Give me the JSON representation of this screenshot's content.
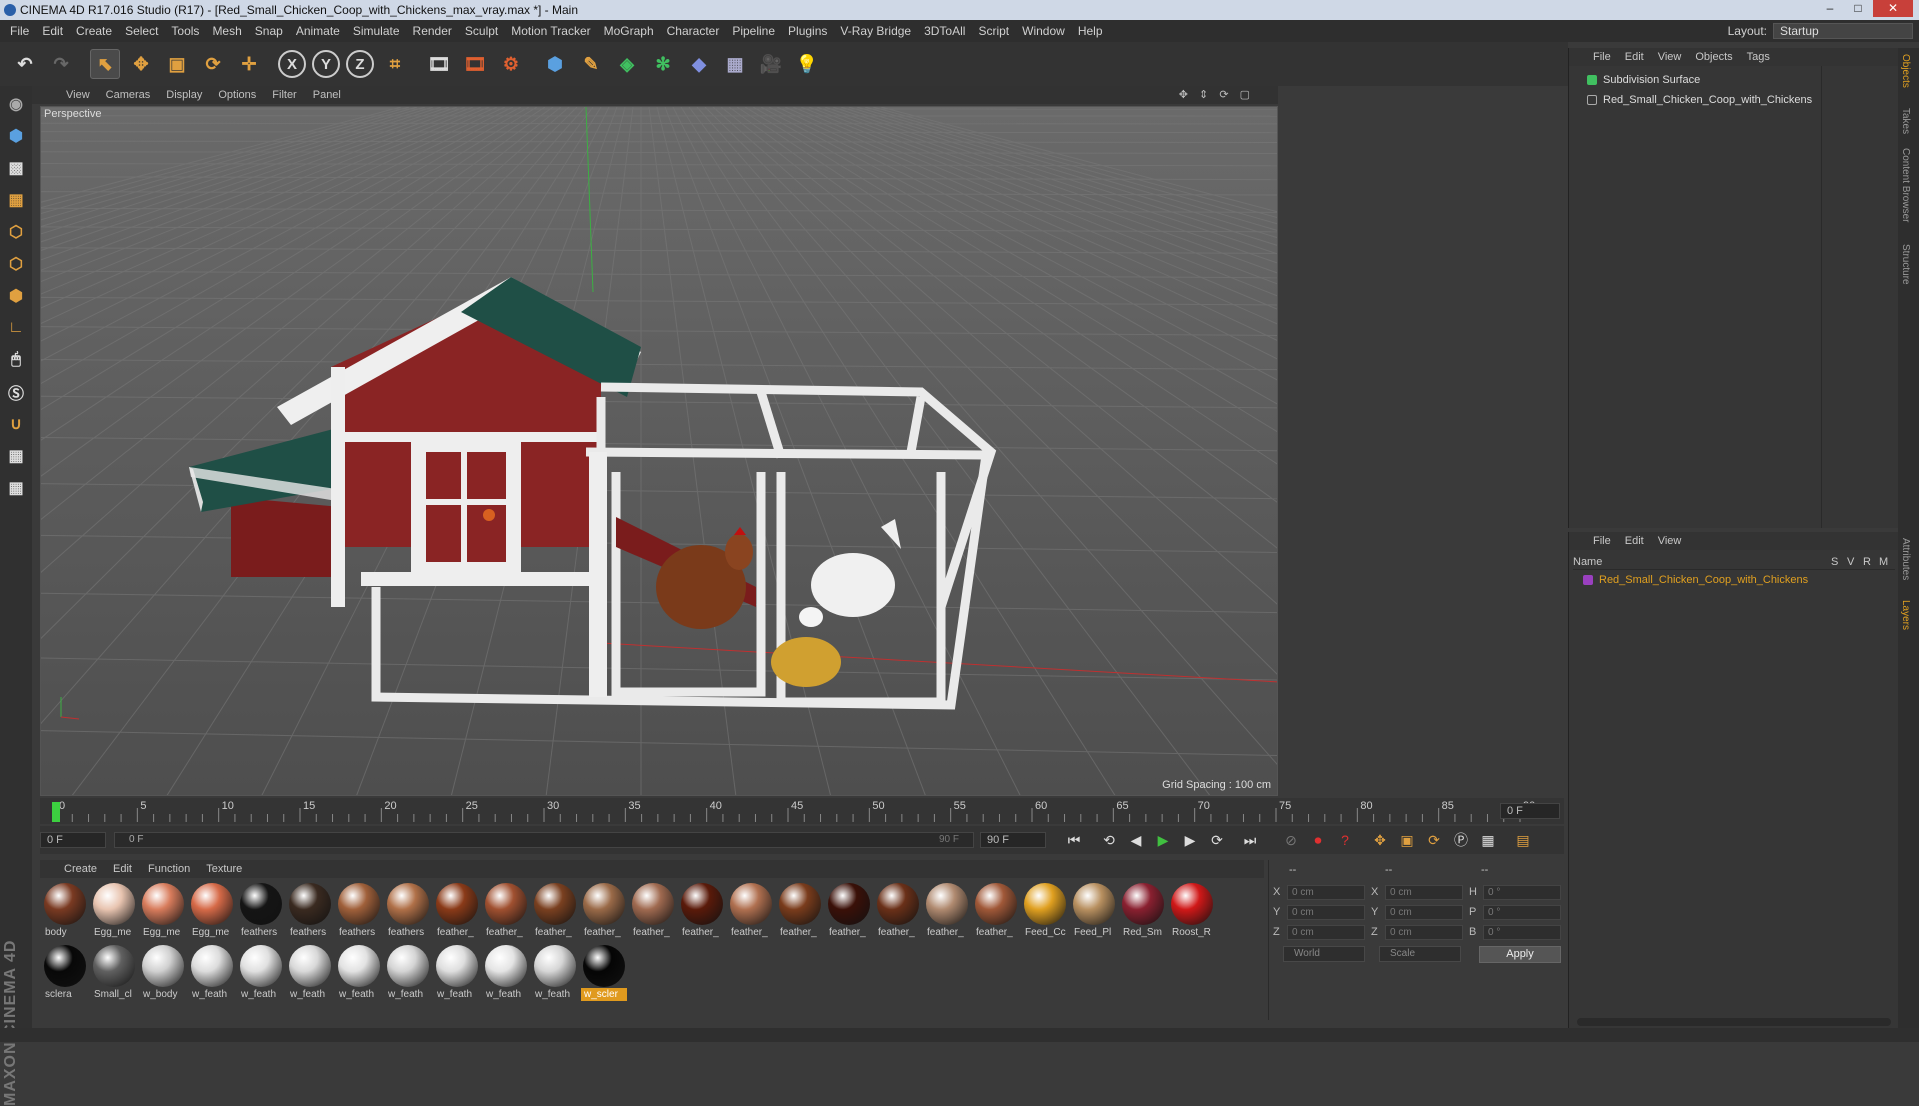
{
  "window": {
    "title": "CINEMA 4D R17.016 Studio (R17) - [Red_Small_Chicken_Coop_with_Chickens_max_vray.max *] - Main"
  },
  "menubar": {
    "items": [
      "File",
      "Edit",
      "Create",
      "Select",
      "Tools",
      "Mesh",
      "Snap",
      "Animate",
      "Simulate",
      "Render",
      "Sculpt",
      "Motion Tracker",
      "MoGraph",
      "Character",
      "Pipeline",
      "Plugins",
      "V-Ray Bridge",
      "3DToAll",
      "Script",
      "Window",
      "Help"
    ],
    "layout_label": "Layout:",
    "layout_value": "Startup"
  },
  "viewport": {
    "menu": [
      "View",
      "Cameras",
      "Display",
      "Options",
      "Filter",
      "Panel"
    ],
    "label": "Perspective",
    "grid_spacing": "Grid Spacing : 100 cm"
  },
  "timeline": {
    "ticks": [
      "0",
      "5",
      "10",
      "15",
      "20",
      "25",
      "30",
      "35",
      "40",
      "45",
      "50",
      "55",
      "60",
      "65",
      "70",
      "75",
      "80",
      "85",
      "90"
    ],
    "end_field": "0 F"
  },
  "playbar": {
    "current": "0 F",
    "range_start": "0 F",
    "range_end": "90 F",
    "end": "90 F"
  },
  "material_menu": [
    "Create",
    "Edit",
    "Function",
    "Texture"
  ],
  "materials": [
    {
      "name": "body",
      "color": "#7a3a22"
    },
    {
      "name": "Egg_me",
      "color": "#e8c4b0"
    },
    {
      "name": "Egg_me",
      "color": "#d87c5c"
    },
    {
      "name": "Egg_me",
      "color": "#d66a48"
    },
    {
      "name": "feathers",
      "color": "#151515"
    },
    {
      "name": "feathers",
      "color": "#3a2a20"
    },
    {
      "name": "feathers",
      "color": "#a0603a"
    },
    {
      "name": "feathers",
      "color": "#b07048"
    },
    {
      "name": "feather_",
      "color": "#8a3a18"
    },
    {
      "name": "feather_",
      "color": "#a05030"
    },
    {
      "name": "feather_",
      "color": "#7a4020"
    },
    {
      "name": "feather_",
      "color": "#9a6a48"
    },
    {
      "name": "feather_",
      "color": "#a06a50"
    },
    {
      "name": "feather_",
      "color": "#5a1a0a"
    },
    {
      "name": "feather_",
      "color": "#b07050"
    },
    {
      "name": "feather_",
      "color": "#7a3c1c"
    },
    {
      "name": "feather_",
      "color": "#3a1008"
    },
    {
      "name": "feather_",
      "color": "#6a3018"
    },
    {
      "name": "feather_",
      "color": "#b08a70"
    },
    {
      "name": "feather_",
      "color": "#a05838"
    },
    {
      "name": "Feed_Cc",
      "color": "#e0a020"
    },
    {
      "name": "Feed_Pl",
      "color": "#b89060"
    },
    {
      "name": "Red_Sm",
      "color": "#8a2030"
    },
    {
      "name": "Roost_R",
      "color": "#d01818"
    },
    {
      "name": "sclera",
      "color": "#080808"
    },
    {
      "name": "Small_cl",
      "color": "#606060"
    },
    {
      "name": "w_body",
      "color": "#d0d0d0"
    },
    {
      "name": "w_feath",
      "color": "#dcdcdc"
    },
    {
      "name": "w_feath",
      "color": "#e0e0e0"
    },
    {
      "name": "w_feath",
      "color": "#d8d8d8"
    },
    {
      "name": "w_feath",
      "color": "#e2e2e2"
    },
    {
      "name": "w_feath",
      "color": "#d4d4d4"
    },
    {
      "name": "w_feath",
      "color": "#dedede"
    },
    {
      "name": "w_feath",
      "color": "#e4e4e4"
    },
    {
      "name": "w_feath",
      "color": "#d6d6d6"
    },
    {
      "name": "w_scler",
      "color": "#050505"
    }
  ],
  "attributes": {
    "header": [
      "--",
      "--",
      "--"
    ],
    "rows": [
      [
        "X",
        "0 cm",
        "X",
        "0 cm",
        "H",
        "0 °"
      ],
      [
        "Y",
        "0 cm",
        "Y",
        "0 cm",
        "P",
        "0 °"
      ],
      [
        "Z",
        "0 cm",
        "Z",
        "0 cm",
        "B",
        "0 °"
      ]
    ],
    "coord_mode": "World",
    "size_mode": "Scale",
    "apply": "Apply"
  },
  "object_manager": {
    "menu": [
      "File",
      "Edit",
      "View",
      "Objects",
      "Tags"
    ],
    "objects": [
      "Subdivision Surface",
      "Red_Small_Chicken_Coop_with_Chickens"
    ]
  },
  "layer_manager": {
    "menu": [
      "File",
      "Edit",
      "View"
    ],
    "columns": [
      "Name",
      "S",
      "V",
      "R",
      "M"
    ],
    "layers": [
      "Red_Small_Chicken_Coop_with_Chickens"
    ],
    "layer_color": "#e0a020"
  },
  "side_tabs": [
    "Objects",
    "Takes",
    "Content Browser",
    "Structure",
    "Attributes",
    "Layers"
  ],
  "brand": "MAXON CINEMA 4D"
}
